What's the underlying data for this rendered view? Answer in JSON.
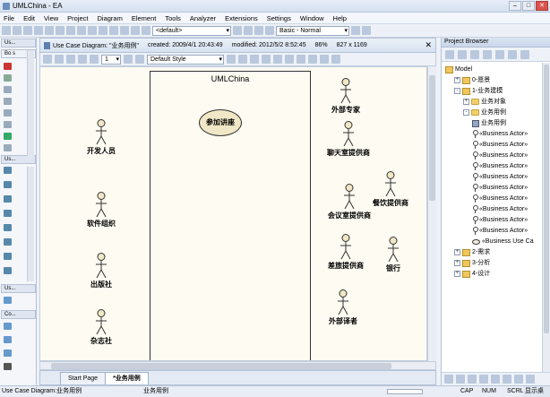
{
  "app": {
    "title": "UMLChina - EA"
  },
  "menu": [
    "File",
    "Edit",
    "View",
    "Project",
    "Diagram",
    "Element",
    "Tools",
    "Analyzer",
    "Extensions",
    "Settings",
    "Window",
    "Help"
  ],
  "toolbar": {
    "combo1": "<default>",
    "combo2": "Basic - Normal"
  },
  "left_toolbox": {
    "sections": [
      "Us...",
      "Us...",
      "Co..."
    ],
    "section_top": "Bo s"
  },
  "diagram_tab": {
    "title": "Use Case Diagram: \"业务用例\"",
    "created": "created: 2009/4/1 20:43:49",
    "modified": "modified: 2012/5/2 8:52:45",
    "zoom": "86%",
    "size": "827 x 1169"
  },
  "diagram_toolbar": {
    "zoom_value": "1",
    "style": "Default Style"
  },
  "diagram": {
    "boundary_title": "UMLChina",
    "use_case": "参加讲座",
    "actors_left": [
      "开发人员",
      "软件组织",
      "出版社",
      "杂志社"
    ],
    "actors_right": [
      "外部专家",
      "聊天室提供商",
      "会议室提供商",
      "餐饮提供商",
      "差旅提供商",
      "银行",
      "外部译者"
    ]
  },
  "bottom_tabs": [
    "Start Page",
    "*业务用例"
  ],
  "project_browser": {
    "title": "Project Browser",
    "tree": [
      {
        "label": "Model",
        "level": 0,
        "kind": "root"
      },
      {
        "label": "0-愿景",
        "level": 1,
        "kind": "pkg",
        "exp": "+"
      },
      {
        "label": "1-业务建模",
        "level": 1,
        "kind": "pkg",
        "exp": "-"
      },
      {
        "label": "业务对象",
        "level": 2,
        "kind": "fold",
        "exp": "+"
      },
      {
        "label": "业务用例",
        "level": 2,
        "kind": "fold",
        "exp": "-"
      },
      {
        "label": "业务用例",
        "level": 3,
        "kind": "diag"
      },
      {
        "label": "«Business Actor»",
        "level": 3,
        "kind": "act"
      },
      {
        "label": "«Business Actor»",
        "level": 3,
        "kind": "act"
      },
      {
        "label": "«Business Actor»",
        "level": 3,
        "kind": "act"
      },
      {
        "label": "«Business Actor»",
        "level": 3,
        "kind": "act"
      },
      {
        "label": "«Business Actor»",
        "level": 3,
        "kind": "act"
      },
      {
        "label": "«Business Actor»",
        "level": 3,
        "kind": "act"
      },
      {
        "label": "«Business Actor»",
        "level": 3,
        "kind": "act"
      },
      {
        "label": "«Business Actor»",
        "level": 3,
        "kind": "act"
      },
      {
        "label": "«Business Actor»",
        "level": 3,
        "kind": "act"
      },
      {
        "label": "«Business Actor»",
        "level": 3,
        "kind": "act"
      },
      {
        "label": "«Business Use Ca",
        "level": 3,
        "kind": "uc"
      },
      {
        "label": "2-需求",
        "level": 1,
        "kind": "pkg",
        "exp": "+"
      },
      {
        "label": "3-分析",
        "level": 1,
        "kind": "pkg",
        "exp": "+"
      },
      {
        "label": "4-设计",
        "level": 1,
        "kind": "pkg",
        "exp": "+"
      }
    ]
  },
  "status": {
    "left": "Use Case Diagram:业务用例",
    "mid": "业务用例",
    "indicators": [
      "CAP",
      "NUM",
      "SCRL"
    ],
    "right": "显示桌面"
  }
}
